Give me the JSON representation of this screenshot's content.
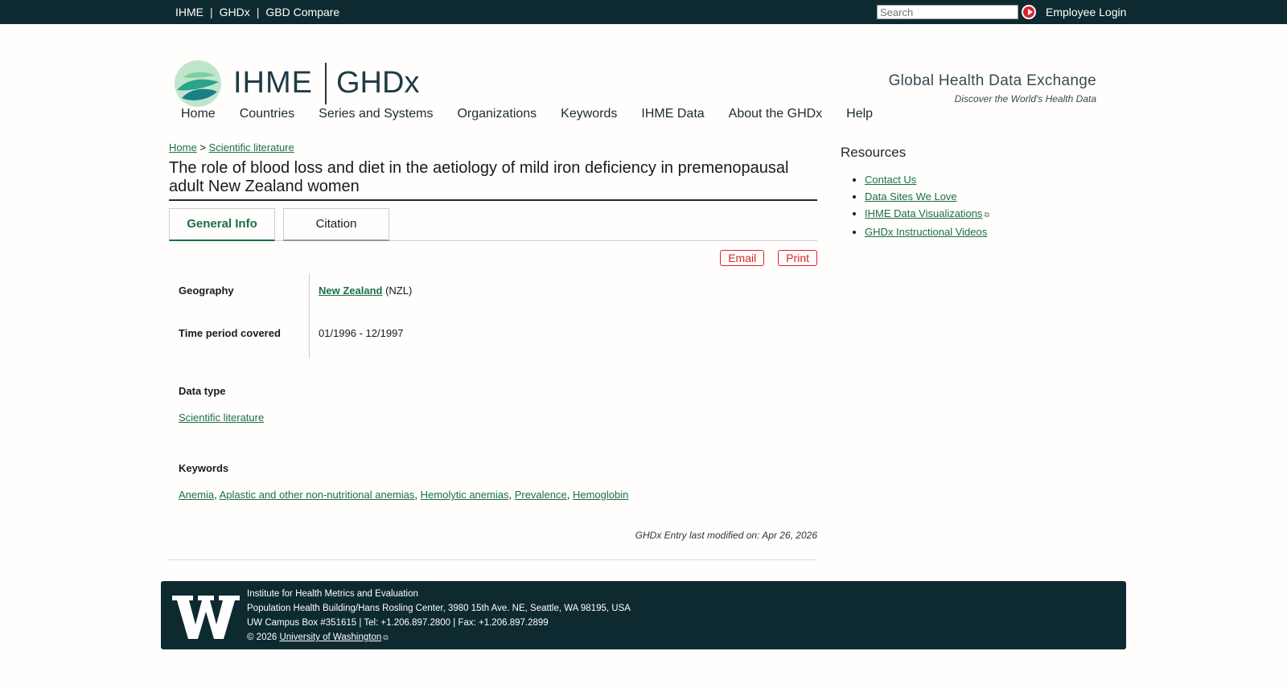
{
  "topbar": {
    "links": [
      "IHME",
      "GHDx",
      "GBD Compare"
    ],
    "search_placeholder": "Search",
    "login": "Employee Login"
  },
  "header": {
    "brand_left": "IHME",
    "brand_right": "GHDx",
    "tagline": "Global Health Data Exchange",
    "subtagline": "Discover the World's Health Data"
  },
  "nav": [
    "Home",
    "Countries",
    "Series and Systems",
    "Organizations",
    "Keywords",
    "IHME Data",
    "About the GHDx",
    "Help"
  ],
  "breadcrumb": {
    "home": "Home",
    "sep": ">",
    "current": "Scientific literature"
  },
  "page_title": "The role of blood loss and diet in the aetiology of mild iron deficiency in premenopausal adult New Zealand women",
  "tabs": [
    "General Info",
    "Citation"
  ],
  "actions": {
    "email": "Email",
    "print": "Print"
  },
  "fields": {
    "geography_label": "Geography",
    "geography_link": "New Zealand",
    "geography_code": "(NZL)",
    "time_label": "Time period covered",
    "time_value": "01/1996 - 12/1997",
    "datatype_label": "Data type",
    "datatype_value": "Scientific literature",
    "keywords_label": "Keywords",
    "keywords": [
      "Anemia",
      "Aplastic and other non-nutritional anemias",
      "Hemolytic anemias",
      "Prevalence",
      "Hemoglobin"
    ]
  },
  "modified": "GHDx Entry last modified on: Apr 26, 2026",
  "sidebar": {
    "title": "Resources",
    "items": [
      "Contact Us",
      "Data Sites We Love",
      "IHME Data Visualizations",
      "GHDx Instructional Videos"
    ]
  },
  "footer": {
    "line1": "Institute for Health Metrics and Evaluation",
    "line2": "Population Health Building/Hans Rosling Center, 3980 15th Ave. NE, Seattle, WA 98195, USA",
    "line3": "UW Campus Box #351615 | Tel: +1.206.897.2800 | Fax: +1.206.897.2899",
    "copyright": "© 2026",
    "uw_link": "University of Washington"
  },
  "colors": {
    "topbar": "#0d2a30",
    "link": "#1b6e4a",
    "action_red": "#d8232a"
  }
}
